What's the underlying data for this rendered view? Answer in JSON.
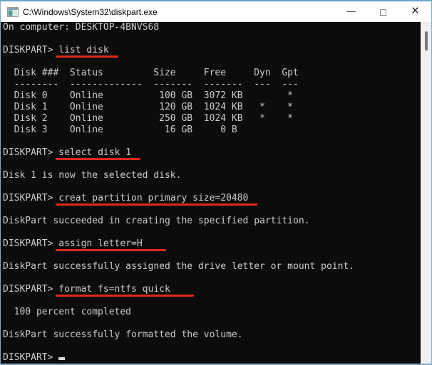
{
  "window": {
    "title": "C:\\Windows\\System32\\diskpart.exe",
    "controls": {
      "minimize_glyph": "—",
      "maximize_glyph": "□",
      "close_glyph": "×"
    }
  },
  "colors": {
    "console_background": "#0c0c0c",
    "console_text": "#cccccc",
    "annotation_red": "#e0281c",
    "window_border_blue": "#7fabc9",
    "titlebar_background": "#ffffff"
  },
  "terminal": {
    "prompt": "DISKPART> ",
    "lines": [
      {
        "name": "computer-name-line",
        "text": "On computer: DESKTOP-4BNVS68"
      },
      {
        "name": "blank-line",
        "text": ""
      },
      {
        "name": "command-line-list-disk",
        "prompt": "DISKPART> ",
        "command": "list disk",
        "underline": true
      },
      {
        "name": "blank-line",
        "text": ""
      },
      {
        "name": "disk-table-header",
        "text": "  Disk ###  Status         Size     Free     Dyn  Gpt"
      },
      {
        "name": "disk-table-divider",
        "text": "  --------  -------------  -------  -------  ---  ---"
      },
      {
        "name": "disk-table-row-0",
        "text": "  Disk 0    Online          100 GB  3072 KB        *"
      },
      {
        "name": "disk-table-row-1",
        "text": "  Disk 1    Online          120 GB  1024 KB   *    *"
      },
      {
        "name": "disk-table-row-2",
        "text": "  Disk 2    Online          250 GB  1024 KB   *    *"
      },
      {
        "name": "disk-table-row-3",
        "text": "  Disk 3    Online           16 GB     0 B"
      },
      {
        "name": "blank-line",
        "text": ""
      },
      {
        "name": "command-line-select-disk",
        "prompt": "DISKPART> ",
        "command": "select disk 1",
        "underline": true
      },
      {
        "name": "blank-line",
        "text": ""
      },
      {
        "name": "output-line-selected",
        "text": "Disk 1 is now the selected disk."
      },
      {
        "name": "blank-line",
        "text": ""
      },
      {
        "name": "command-line-create-partition",
        "prompt": "DISKPART> ",
        "command": "creat partition primary size=20480",
        "underline": true
      },
      {
        "name": "blank-line",
        "text": ""
      },
      {
        "name": "output-line-partition-created",
        "text": "DiskPart succeeded in creating the specified partition."
      },
      {
        "name": "blank-line",
        "text": ""
      },
      {
        "name": "command-line-assign-letter",
        "prompt": "DISKPART> ",
        "command": "assign letter=H",
        "underline": true,
        "underline_long": true
      },
      {
        "name": "blank-line",
        "text": ""
      },
      {
        "name": "output-line-letter-assigned",
        "text": "DiskPart successfully assigned the drive letter or mount point."
      },
      {
        "name": "blank-line",
        "text": ""
      },
      {
        "name": "command-line-format",
        "prompt": "DISKPART> ",
        "command": "format fs=ntfs quick",
        "underline": true,
        "underline_long": true
      },
      {
        "name": "blank-line",
        "text": ""
      },
      {
        "name": "output-line-percent",
        "text": "  100 percent completed"
      },
      {
        "name": "blank-line",
        "text": ""
      },
      {
        "name": "output-line-formatted",
        "text": "DiskPart successfully formatted the volume."
      },
      {
        "name": "blank-line",
        "text": ""
      },
      {
        "name": "prompt-line-final",
        "prompt": "DISKPART> ",
        "cursor": true
      }
    ]
  }
}
